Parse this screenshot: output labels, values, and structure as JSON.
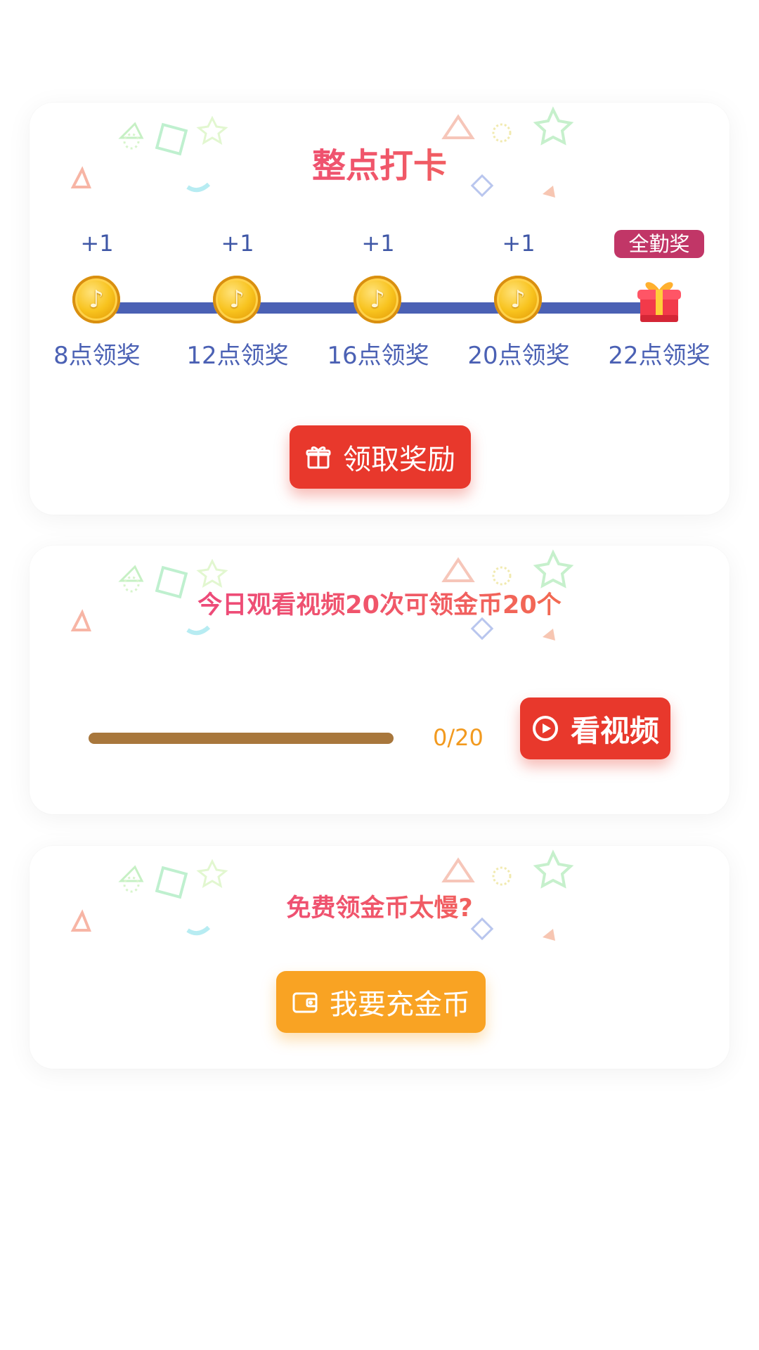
{
  "checkin": {
    "title": "整点打卡",
    "nodes": [
      {
        "bonus": "+1",
        "time": "8点领奖",
        "type": "coin"
      },
      {
        "bonus": "+1",
        "time": "12点领奖",
        "type": "coin"
      },
      {
        "bonus": "+1",
        "time": "16点领奖",
        "type": "coin"
      },
      {
        "bonus": "+1",
        "time": "20点领奖",
        "type": "coin"
      },
      {
        "badge": "全勤奖",
        "time": "22点领奖",
        "type": "gift"
      }
    ],
    "claim_label": "领取奖励"
  },
  "video": {
    "title": "今日观看视频20次可领金币20个",
    "progress_text": "0/20",
    "progress_value": 0,
    "progress_max": 20,
    "watch_label": "看视频"
  },
  "recharge": {
    "title": "免费领金币太慢?",
    "button_label": "我要充金币"
  },
  "colors": {
    "accent_red": "#e8382c",
    "accent_orange": "#f9a323",
    "timeline_blue": "#4b61b4",
    "badge": "#c13667",
    "progress_track": "#a8773c"
  },
  "icons": {
    "coin": "music-note-coin-icon",
    "gift": "gift-box-icon",
    "claim": "gift-outline-icon",
    "watch": "play-circle-icon",
    "recharge": "wallet-icon"
  }
}
